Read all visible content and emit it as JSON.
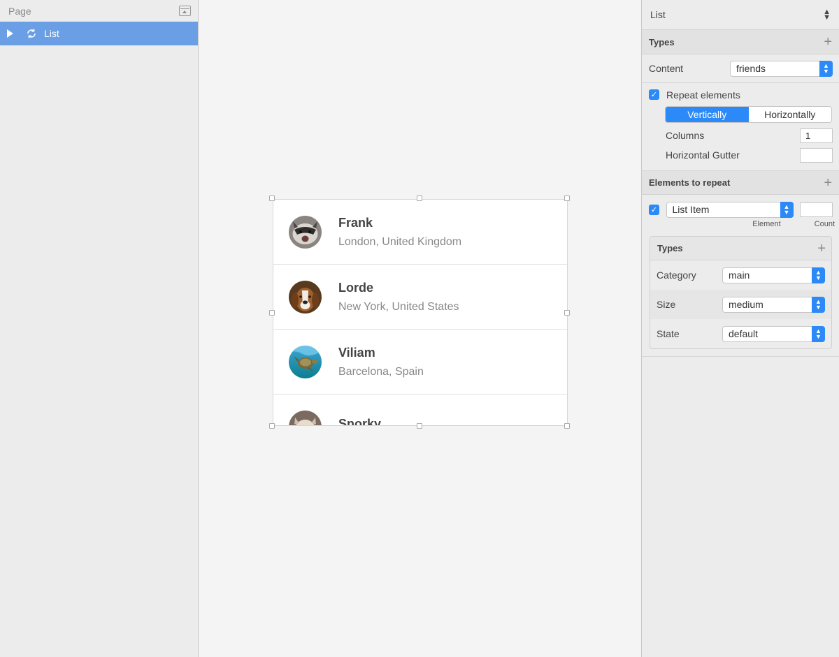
{
  "left_panel": {
    "title": "Page",
    "layer_name": "List"
  },
  "list_items": [
    {
      "name": "Frank",
      "location": "London, United Kingdom"
    },
    {
      "name": "Lorde",
      "location": "New York, United States"
    },
    {
      "name": "Viliam",
      "location": "Barcelona, Spain"
    },
    {
      "name": "Snorky",
      "location": ""
    }
  ],
  "inspector": {
    "symbol_name": "List",
    "types_label": "Types",
    "content_label": "Content",
    "content_value": "friends",
    "repeat_label": "Repeat elements",
    "repeat_checked": true,
    "direction_options": [
      "Vertically",
      "Horizontally"
    ],
    "direction_selected": "Vertically",
    "columns_label": "Columns",
    "columns_value": "1",
    "gutter_label": "Horizontal Gutter",
    "gutter_value": "",
    "elements_label": "Elements to repeat",
    "element_value": "List Item",
    "element_checked": true,
    "count_value": "",
    "element_caption": "Element",
    "count_caption": "Count",
    "sub_types_label": "Types",
    "category_label": "Category",
    "category_value": "main",
    "size_label": "Size",
    "size_value": "medium",
    "state_label": "State",
    "state_value": "default"
  },
  "colors": {
    "accent": "#2b8af7",
    "selection": "#6a9ee5"
  }
}
